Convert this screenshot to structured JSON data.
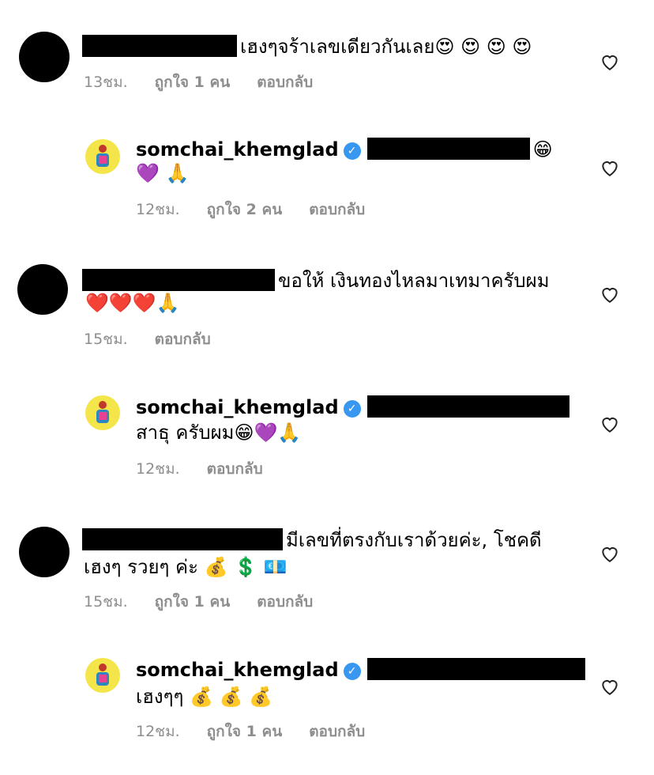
{
  "comments": [
    {
      "text": "เฮงๆจร้าเลขเดียวกันเลย",
      "emoji": "😍 😍 😍 😍",
      "time": "13ชม.",
      "likes": "ถูกใจ 1 คน",
      "reply": "ตอบกลับ"
    },
    {
      "user": "somchai_khemglad",
      "line1_emoji": "😁",
      "line2": "💜 🙏",
      "time": "12ชม.",
      "likes": "ถูกใจ 2 คน",
      "reply": "ตอบกลับ"
    },
    {
      "text": "ขอให้ เงินทองไหลมาเทมาครับผม",
      "line2": "❤️❤️❤️🙏",
      "time": "15ชม.",
      "reply": "ตอบกลับ"
    },
    {
      "user": "somchai_khemglad",
      "line2": "สาธุ ครับผม😁💜🙏",
      "time": "12ชม.",
      "reply": "ตอบกลับ"
    },
    {
      "text": "มีเลขที่ตรงกับเราด้วยค่ะ, โชคดี",
      "line2": "เฮงๆ รวยๆ ค่ะ 💰 💲 💶",
      "time": "15ชม.",
      "likes": "ถูกใจ 1 คน",
      "reply": "ตอบกลับ"
    },
    {
      "user": "somchai_khemglad",
      "line2": "เฮงๆๆ 💰 💰 💰",
      "time": "12ชม.",
      "likes": "ถูกใจ 1 คน",
      "reply": "ตอบกลับ"
    }
  ],
  "icons": {
    "heart": "heart-outline-icon",
    "verified": "verified-badge-icon",
    "accent": "#3897f0"
  }
}
